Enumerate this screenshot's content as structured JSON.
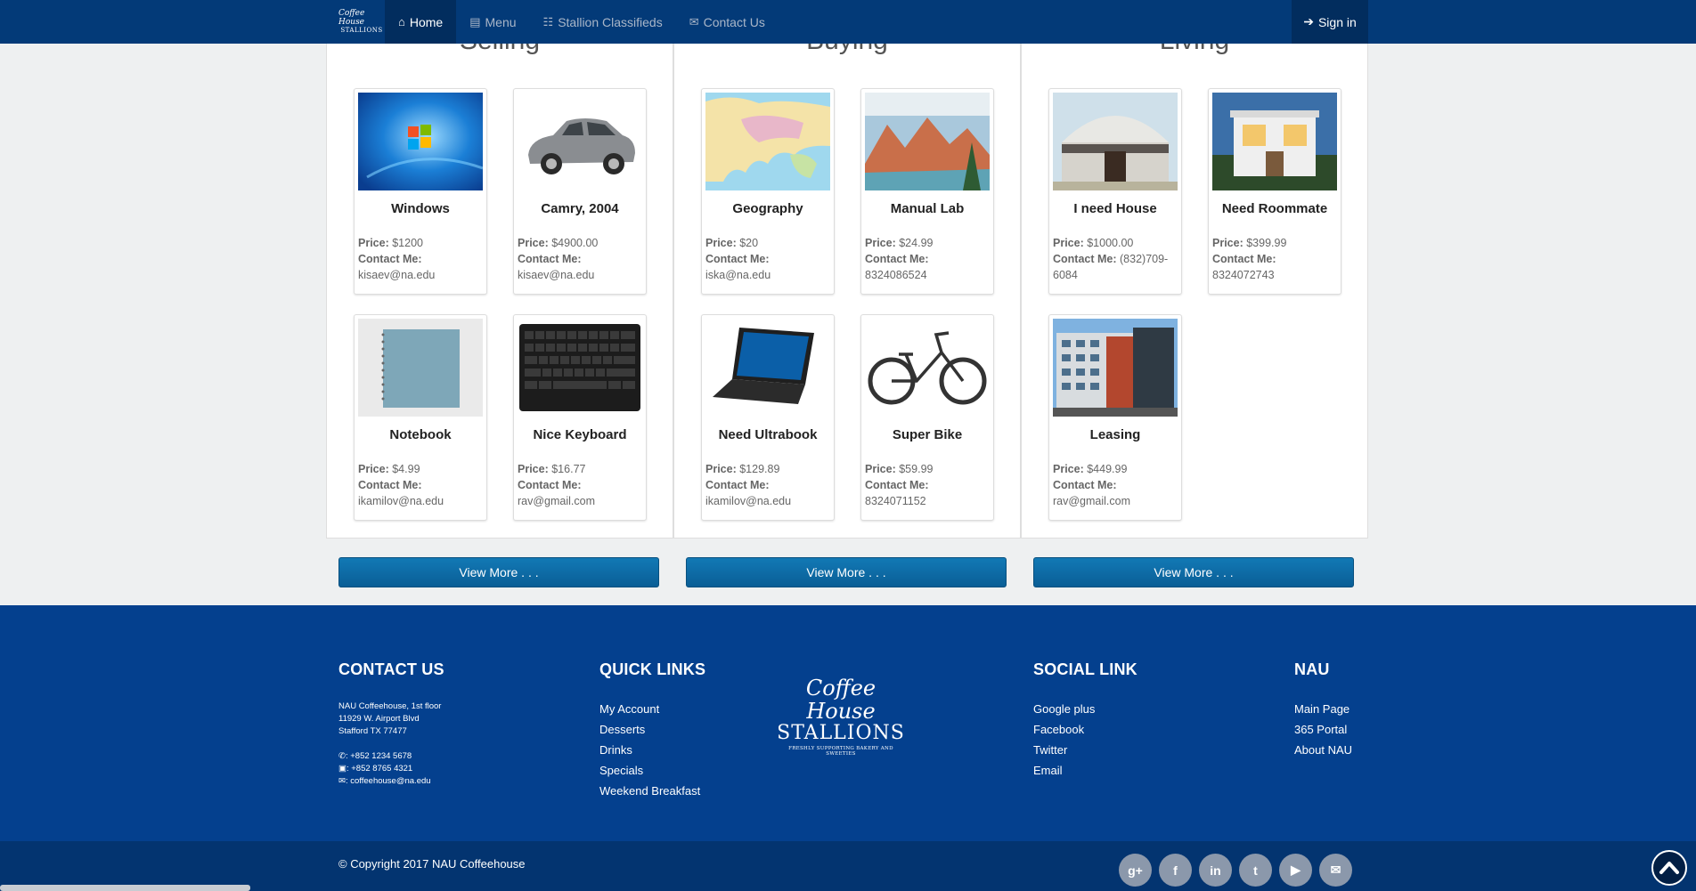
{
  "nav": {
    "logo_line1": "Coffee House",
    "logo_line2": "STALLIONS",
    "items": [
      {
        "label": "Home",
        "icon": "home-icon"
      },
      {
        "label": "Menu",
        "icon": "book-icon"
      },
      {
        "label": "Stallion Classifieds",
        "icon": "list-icon"
      },
      {
        "label": "Contact Us",
        "icon": "envelope-icon"
      }
    ],
    "signin": "Sign in"
  },
  "panels": [
    {
      "title": "Selling",
      "cards": [
        {
          "title": "Windows",
          "price": "$1200",
          "contact": "kisaev@na.edu",
          "icon": "windows-icon"
        },
        {
          "title": "Camry, 2004",
          "price": "$4900.00",
          "contact": "kisaev@na.edu",
          "icon": "car-icon"
        },
        {
          "title": "Notebook",
          "price": "$4.99",
          "contact": "ikamilov@na.edu",
          "icon": "notebook-icon"
        },
        {
          "title": "Nice Keyboard",
          "price": "$16.77",
          "contact": "rav@gmail.com",
          "icon": "keyboard-icon"
        }
      ]
    },
    {
      "title": "Buying",
      "cards": [
        {
          "title": "Geography",
          "price": "$20",
          "contact": "iska@na.edu",
          "icon": "map-icon"
        },
        {
          "title": "Manual Lab",
          "price": "$24.99",
          "contact": "8324086524",
          "icon": "book-cover-icon"
        },
        {
          "title": "Need Ultrabook",
          "price": "$129.89",
          "contact": "ikamilov@na.edu",
          "icon": "laptop-icon"
        },
        {
          "title": "Super Bike",
          "price": "$59.99",
          "contact": "8324071152",
          "icon": "bicycle-icon"
        }
      ]
    },
    {
      "title": "Living",
      "cards": [
        {
          "title": "I need House",
          "price": "$1000.00",
          "contact": "(832)709-6084",
          "icon": "yurt-icon"
        },
        {
          "title": "Need Roommate",
          "price": "$399.99",
          "contact": "8324072743",
          "icon": "house-icon"
        },
        {
          "title": "Leasing",
          "price": "$449.99",
          "contact": "rav@gmail.com",
          "icon": "building-icon"
        }
      ]
    }
  ],
  "labels": {
    "price": "Price:",
    "contact": "Contact Me:",
    "view_more": "View More . . ."
  },
  "footer": {
    "contact_head": "CONTACT US",
    "address1": "NAU Coffeehouse, 1st floor",
    "address2": "11929 W. Airport Blvd",
    "address3": "Stafford TX 77477",
    "phone": ": +852 1234 5678",
    "fax": ": +852 8765 4321",
    "email": ": coffeehouse@na.edu",
    "quick_head": "QUICK LINKS",
    "quick_links": [
      "My Account",
      "Desserts",
      "Drinks",
      "Specials",
      "Weekend Breakfast"
    ],
    "logo_line1": "Coffee House",
    "logo_line2": "STALLIONS",
    "logo_line3": "FRESHLY SUPPORTING BAKERY AND SWEETIES",
    "social_head": "SOCIAL LINK",
    "social_links": [
      "Google plus",
      "Facebook",
      "Twitter",
      "Email"
    ],
    "nau_head": "NAU",
    "nau_links": [
      "Main Page",
      "365 Portal",
      "About NAU"
    ],
    "copyright": "© Copyright 2017 NAU Coffeehouse",
    "social_icons": [
      {
        "name": "google-plus-icon",
        "glyph": "g+"
      },
      {
        "name": "facebook-icon",
        "glyph": "f"
      },
      {
        "name": "linkedin-icon",
        "glyph": "in"
      },
      {
        "name": "twitter-icon",
        "glyph": "t"
      },
      {
        "name": "youtube-icon",
        "glyph": "▶"
      },
      {
        "name": "email-icon",
        "glyph": "✉"
      }
    ]
  },
  "colors": {
    "nav": "#033a78",
    "footer": "#04408e",
    "button": "#0a6aa6"
  }
}
